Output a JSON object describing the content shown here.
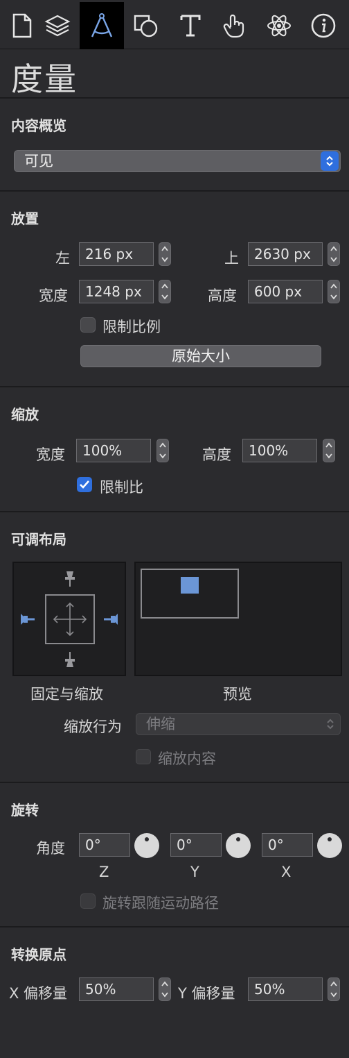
{
  "toolbar": {
    "tabs": [
      {
        "name": "document-icon"
      },
      {
        "name": "layers-icon"
      },
      {
        "name": "metrics-compass-icon",
        "active": true
      },
      {
        "name": "shapes-icon"
      },
      {
        "name": "text-icon"
      },
      {
        "name": "interaction-hand-icon"
      },
      {
        "name": "atom-icon"
      },
      {
        "name": "info-icon"
      }
    ]
  },
  "page_title": "度量",
  "content_overview": {
    "heading": "内容概览",
    "visibility_value": "可见"
  },
  "placement": {
    "heading": "放置",
    "left_label": "左",
    "left_value": "216 px",
    "top_label": "上",
    "top_value": "2630 px",
    "width_label": "宽度",
    "width_value": "1248 px",
    "height_label": "高度",
    "height_value": "600 px",
    "constrain_label": "限制比例",
    "constrain_checked": false,
    "original_size_label": "原始大小"
  },
  "scale": {
    "heading": "缩放",
    "width_label": "宽度",
    "width_value": "100%",
    "height_label": "高度",
    "height_value": "100%",
    "constrain_label": "限制比",
    "constrain_checked": true
  },
  "adaptive_layout": {
    "heading": "可调布局",
    "pin_label": "固定与缩放",
    "preview_label": "预览",
    "scale_behavior_label": "缩放行为",
    "scale_behavior_value": "伸缩",
    "scale_content_label": "缩放内容",
    "scale_content_checked": false,
    "accent_color": "#6b96d6"
  },
  "rotation": {
    "heading": "旋转",
    "angle_label": "角度",
    "z_value": "0°",
    "y_value": "0°",
    "x_value": "0°",
    "z_axis": "Z",
    "y_axis": "Y",
    "x_axis": "X",
    "follow_path_label": "旋转跟随运动路径",
    "follow_path_checked": false
  },
  "transform_origin": {
    "heading": "转换原点",
    "x_offset_label": "X 偏移量",
    "x_offset_value": "50%",
    "y_offset_label": "Y 偏移量",
    "y_offset_value": "50%"
  }
}
